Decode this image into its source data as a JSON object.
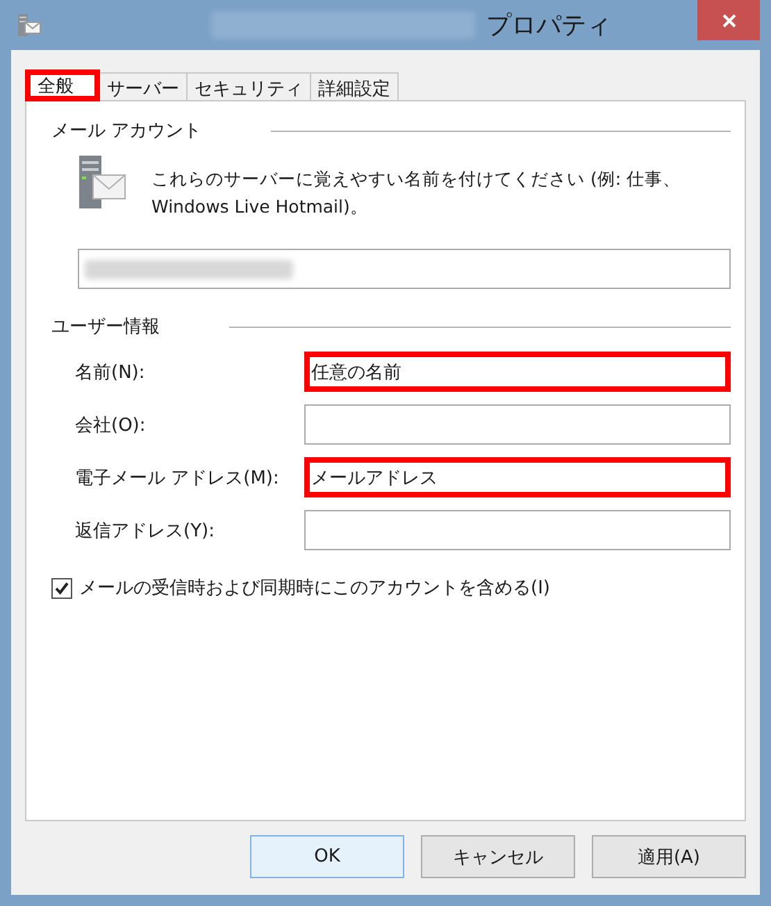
{
  "window": {
    "title_redacted": true,
    "title": "プロパティ"
  },
  "tabs": [
    {
      "label": "全般",
      "selected": true,
      "highlighted": true
    },
    {
      "label": "サーバー",
      "selected": false,
      "highlighted": false
    },
    {
      "label": "セキュリティ",
      "selected": false,
      "highlighted": false
    },
    {
      "label": "詳細設定",
      "selected": false,
      "highlighted": false
    }
  ],
  "mail_account": {
    "heading": "メール アカウント",
    "description": "これらのサーバーに覚えやすい名前を付けてください (例: 仕事、Windows Live Hotmail)。",
    "field_redacted": true
  },
  "user_info": {
    "heading": "ユーザー情報",
    "fields": [
      {
        "label": "名前(N):",
        "value": "任意の名前",
        "highlighted": true
      },
      {
        "label": "会社(O):",
        "highlighted": false
      },
      {
        "label": "電子メール アドレス(M):",
        "value": "メールアドレス",
        "highlighted": true
      },
      {
        "label": "返信アドレス(Y):",
        "highlighted": false
      }
    ]
  },
  "include_account": {
    "label": "メールの受信時および同期時にこのアカウントを含める(I)",
    "checked": true
  },
  "buttons": [
    {
      "label": "OK",
      "default": true
    },
    {
      "label": "キャンセル",
      "default": false
    },
    {
      "label": "適用(A)",
      "default": false
    }
  ]
}
